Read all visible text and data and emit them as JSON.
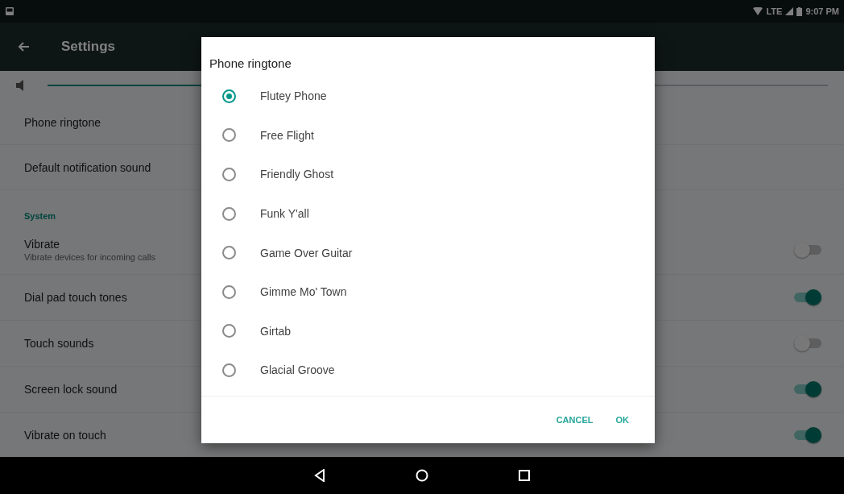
{
  "status_bar": {
    "network": "LTE",
    "time": "9:07 PM"
  },
  "app_bar": {
    "title": "Settings"
  },
  "volume_slider": {
    "level": 0.5
  },
  "settings": [
    {
      "kind": "item",
      "title": "Phone ringtone"
    },
    {
      "kind": "item",
      "title": "Default notification sound"
    },
    {
      "kind": "header",
      "title": "System"
    },
    {
      "kind": "switch",
      "title": "Vibrate",
      "subtitle": "Vibrate devices for incoming calls",
      "on": false
    },
    {
      "kind": "switch",
      "title": "Dial pad touch tones",
      "on": true
    },
    {
      "kind": "switch",
      "title": "Touch sounds",
      "on": false
    },
    {
      "kind": "switch",
      "title": "Screen lock sound",
      "on": true
    },
    {
      "kind": "switch",
      "title": "Vibrate on touch",
      "on": true
    }
  ],
  "dialog": {
    "title": "Phone ringtone",
    "options": [
      {
        "label": "Flutey Phone",
        "selected": true
      },
      {
        "label": "Free Flight",
        "selected": false
      },
      {
        "label": "Friendly Ghost",
        "selected": false
      },
      {
        "label": "Funk Y'all",
        "selected": false
      },
      {
        "label": "Game Over Guitar",
        "selected": false
      },
      {
        "label": "Gimme Mo' Town",
        "selected": false
      },
      {
        "label": "Girtab",
        "selected": false
      },
      {
        "label": "Glacial Groove",
        "selected": false
      }
    ],
    "buttons": [
      "CANCEL",
      "OK"
    ]
  }
}
